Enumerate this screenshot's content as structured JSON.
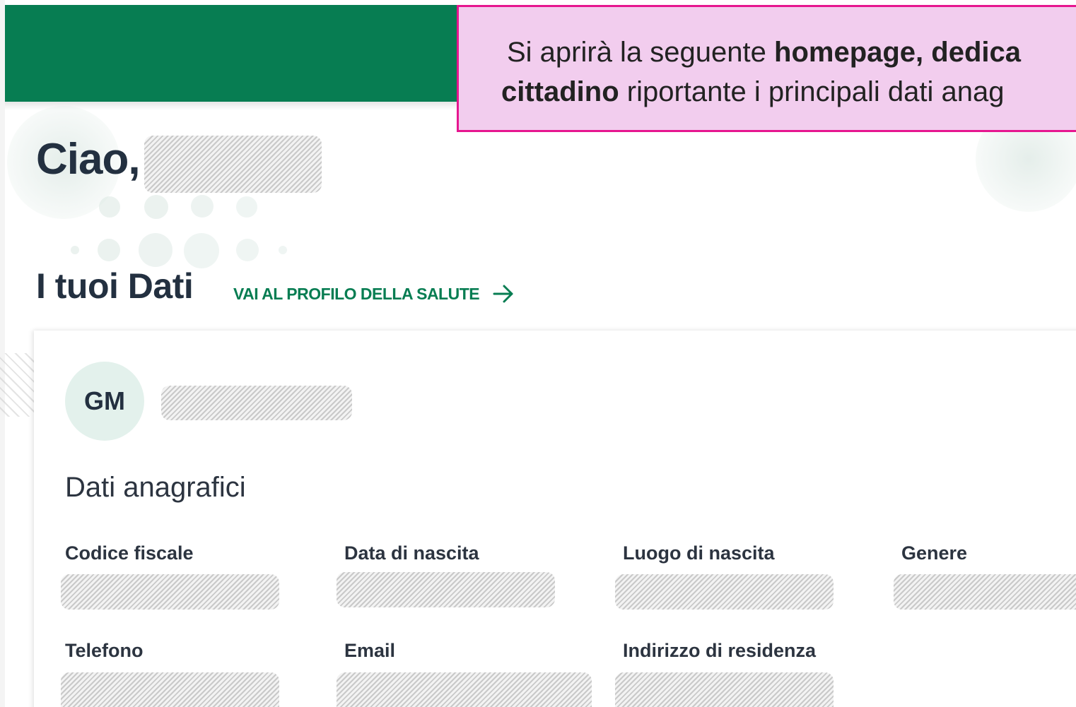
{
  "callout": {
    "line1_prefix": "Si aprirà la seguente ",
    "line1_bold": "homepage, dedica",
    "line2_bold": "cittadino",
    "line2_suffix": " riportante i principali dati anag"
  },
  "greeting": {
    "label": "Ciao,"
  },
  "section": {
    "title": "I tuoi Dati",
    "profile_link": "VAI AL PROFILO DELLA SALUTE",
    "profile_link_icon": "arrow-right-icon"
  },
  "user": {
    "initials": "GM"
  },
  "anagrafica": {
    "title": "Dati anagrafici",
    "fields": [
      {
        "label": "Codice fiscale"
      },
      {
        "label": "Data di nascita"
      },
      {
        "label": "Luogo di nascita"
      },
      {
        "label": "Genere"
      },
      {
        "label": "Telefono"
      },
      {
        "label": "Email"
      },
      {
        "label": "Indirizzo di residenza"
      }
    ]
  },
  "colors": {
    "header_green": "#077d52",
    "link_green": "#077d52",
    "callout_bg": "#f2cdee",
    "callout_border": "#e6168f",
    "text_dark": "#233040",
    "avatar_bg": "#e3f1ec"
  }
}
